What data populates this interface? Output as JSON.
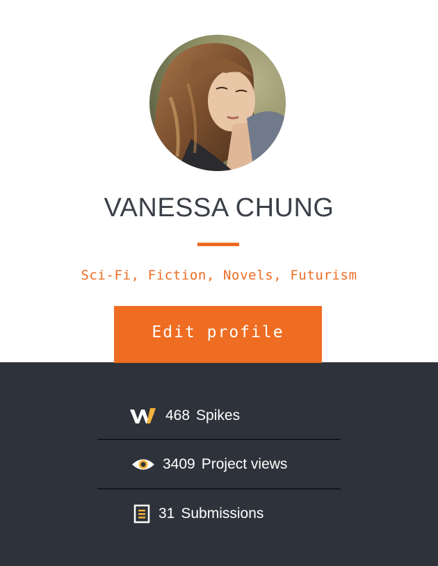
{
  "profile": {
    "avatar_icon": "profile-photo",
    "name": "VANESSA CHUNG",
    "tags": "Sci-Fi, Fiction, Novels, Futurism",
    "edit_label": "Edit profile"
  },
  "stats": [
    {
      "icon": "spikes-logo-icon",
      "count": "468",
      "label": "Spikes"
    },
    {
      "icon": "eye-icon",
      "count": "3409",
      "label": "Project views"
    },
    {
      "icon": "document-icon",
      "count": "31",
      "label": "Submissions"
    }
  ],
  "colors": {
    "accent": "#ec6b22",
    "dark_panel": "#2e333b",
    "name_text": "#3a3f47",
    "icon_gold": "#f2b13a"
  }
}
